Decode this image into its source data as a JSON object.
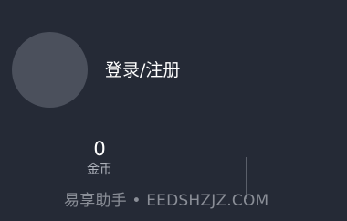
{
  "profile": {
    "login_label": "登录/注册"
  },
  "stats": {
    "coins": {
      "value": "0",
      "label": "金币"
    }
  },
  "watermark": {
    "text": "易享助手 • EEDSHZJZ.COM"
  },
  "colors": {
    "background": "#252a36",
    "avatar_placeholder": "#4b505c",
    "primary_text": "#ffffff",
    "secondary_text": "#aeb2bb"
  }
}
